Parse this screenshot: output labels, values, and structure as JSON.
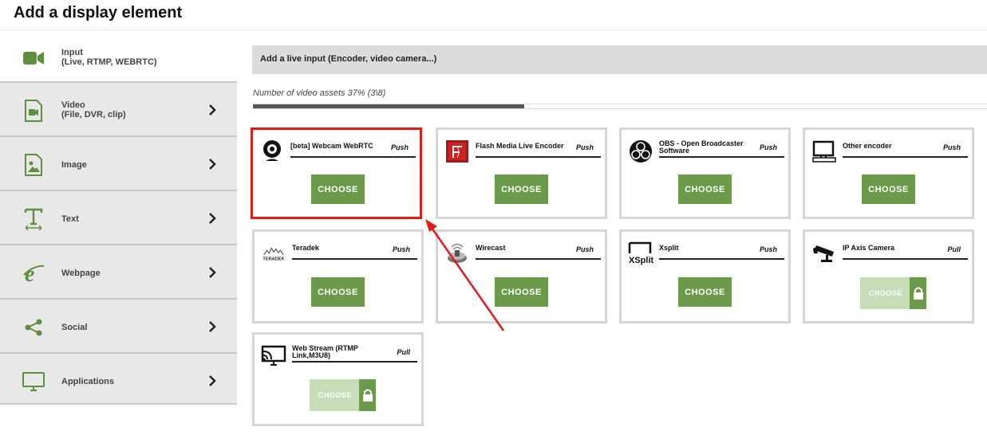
{
  "page": {
    "title": "Add a display element"
  },
  "sidebar": {
    "items": [
      {
        "label": "Input",
        "sub": "(Live, RTMP, WEBRTC)",
        "icon": "video-camera-icon"
      },
      {
        "label": "Video",
        "sub": "(File, DVR, clip)",
        "icon": "video-file-icon"
      },
      {
        "label": "Image",
        "sub": "",
        "icon": "image-icon"
      },
      {
        "label": "Text",
        "sub": "",
        "icon": "text-icon"
      },
      {
        "label": "Webpage",
        "sub": "",
        "icon": "webpage-icon"
      },
      {
        "label": "Social",
        "sub": "",
        "icon": "share-icon"
      },
      {
        "label": "Applications",
        "sub": "",
        "icon": "monitor-icon"
      }
    ]
  },
  "main": {
    "header": "Add a live input (Encoder, video camera...)",
    "progress": {
      "label": "Number of video assets 37% (3\\8)",
      "fraction": 0.37
    },
    "cards": [
      {
        "name": "[beta] Webcam WebRTC",
        "type": "Push",
        "button": "CHOOSE",
        "locked": false,
        "selected": true,
        "icon": "webcam-icon"
      },
      {
        "name": "Flash Media Live Encoder",
        "type": "Push",
        "button": "CHOOSE",
        "locked": false,
        "selected": false,
        "icon": "flash-icon"
      },
      {
        "name": "OBS - Open Broadcaster Software",
        "type": "Push",
        "button": "CHOOSE",
        "locked": false,
        "selected": false,
        "icon": "obs-icon"
      },
      {
        "name": "Other encoder",
        "type": "Push",
        "button": "CHOOSE",
        "locked": false,
        "selected": false,
        "icon": "computer-icon"
      },
      {
        "name": "Teradek",
        "type": "Push",
        "button": "CHOOSE",
        "locked": false,
        "selected": false,
        "icon": "teradek-logo",
        "logo_text": "TERADEK"
      },
      {
        "name": "Wirecast",
        "type": "Push",
        "button": "CHOOSE",
        "locked": false,
        "selected": false,
        "icon": "wirecast-icon"
      },
      {
        "name": "Xsplit",
        "type": "Push",
        "button": "CHOOSE",
        "locked": false,
        "selected": false,
        "icon": "xsplit-logo",
        "logo_text": "XSplit"
      },
      {
        "name": "IP Axis Camera",
        "type": "Pull",
        "button": "CHOOSE",
        "locked": true,
        "selected": false,
        "icon": "security-camera-icon"
      },
      {
        "name": "Web Stream (RTMP Link,M3U8)",
        "type": "Pull",
        "button": "CHOOSE",
        "locked": true,
        "selected": false,
        "icon": "cast-screen-icon"
      }
    ]
  },
  "colors": {
    "accent_green": "#6a9a4a",
    "locked_green": "#c8dcb8",
    "highlight_red": "#e11b1b",
    "sidebar_gray": "#e8e8e8"
  }
}
